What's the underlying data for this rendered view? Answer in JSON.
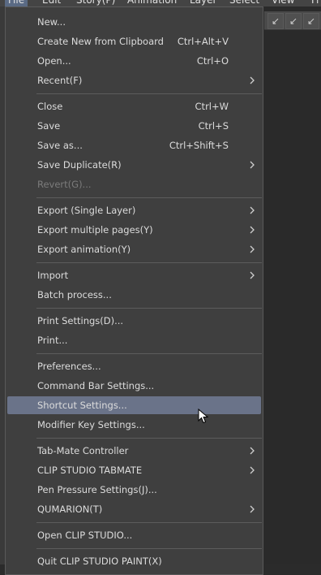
{
  "menubar": {
    "items": [
      "File",
      "Edit",
      "Story(P)",
      "Animation",
      "Layer",
      "Select",
      "View",
      "Fi"
    ]
  },
  "file_menu": {
    "groups": [
      [
        {
          "label": "New..."
        },
        {
          "label": "Create New from Clipboard",
          "shortcut": "Ctrl+Alt+V"
        },
        {
          "label": "Open...",
          "shortcut": "Ctrl+O"
        },
        {
          "label": "Recent(F)",
          "submenu": true
        }
      ],
      [
        {
          "label": "Close",
          "shortcut": "Ctrl+W"
        },
        {
          "label": "Save",
          "shortcut": "Ctrl+S"
        },
        {
          "label": "Save as...",
          "shortcut": "Ctrl+Shift+S"
        },
        {
          "label": "Save Duplicate(R)",
          "submenu": true
        },
        {
          "label": "Revert(G)...",
          "disabled": true
        }
      ],
      [
        {
          "label": "Export (Single Layer)",
          "submenu": true
        },
        {
          "label": "Export multiple pages(Y)",
          "submenu": true
        },
        {
          "label": "Export animation(Y)",
          "submenu": true
        }
      ],
      [
        {
          "label": "Import",
          "submenu": true
        },
        {
          "label": "Batch process..."
        }
      ],
      [
        {
          "label": "Print Settings(D)..."
        },
        {
          "label": "Print..."
        }
      ],
      [
        {
          "label": "Preferences..."
        },
        {
          "label": "Command Bar Settings..."
        },
        {
          "label": "Shortcut Settings...",
          "highlighted": true
        },
        {
          "label": "Modifier Key Settings..."
        }
      ],
      [
        {
          "label": "Tab-Mate Controller",
          "submenu": true
        },
        {
          "label": "CLIP STUDIO TABMATE",
          "submenu": true
        },
        {
          "label": "Pen Pressure Settings(J)..."
        },
        {
          "label": "QUMARION(T)",
          "submenu": true
        }
      ],
      [
        {
          "label": "Open CLIP STUDIO..."
        }
      ],
      [
        {
          "label": "Quit CLIP STUDIO PAINT(X)"
        }
      ]
    ]
  },
  "colors": {
    "menu_bg": "#3f3f3f",
    "highlight": "#6a7389",
    "separator": "#5c5c5c",
    "text": "#dcdcdc",
    "disabled_text": "#7b7b7b"
  },
  "icons": [
    "chevron-right-icon",
    "mouse-pointer-icon",
    "pen-tool-icon"
  ]
}
